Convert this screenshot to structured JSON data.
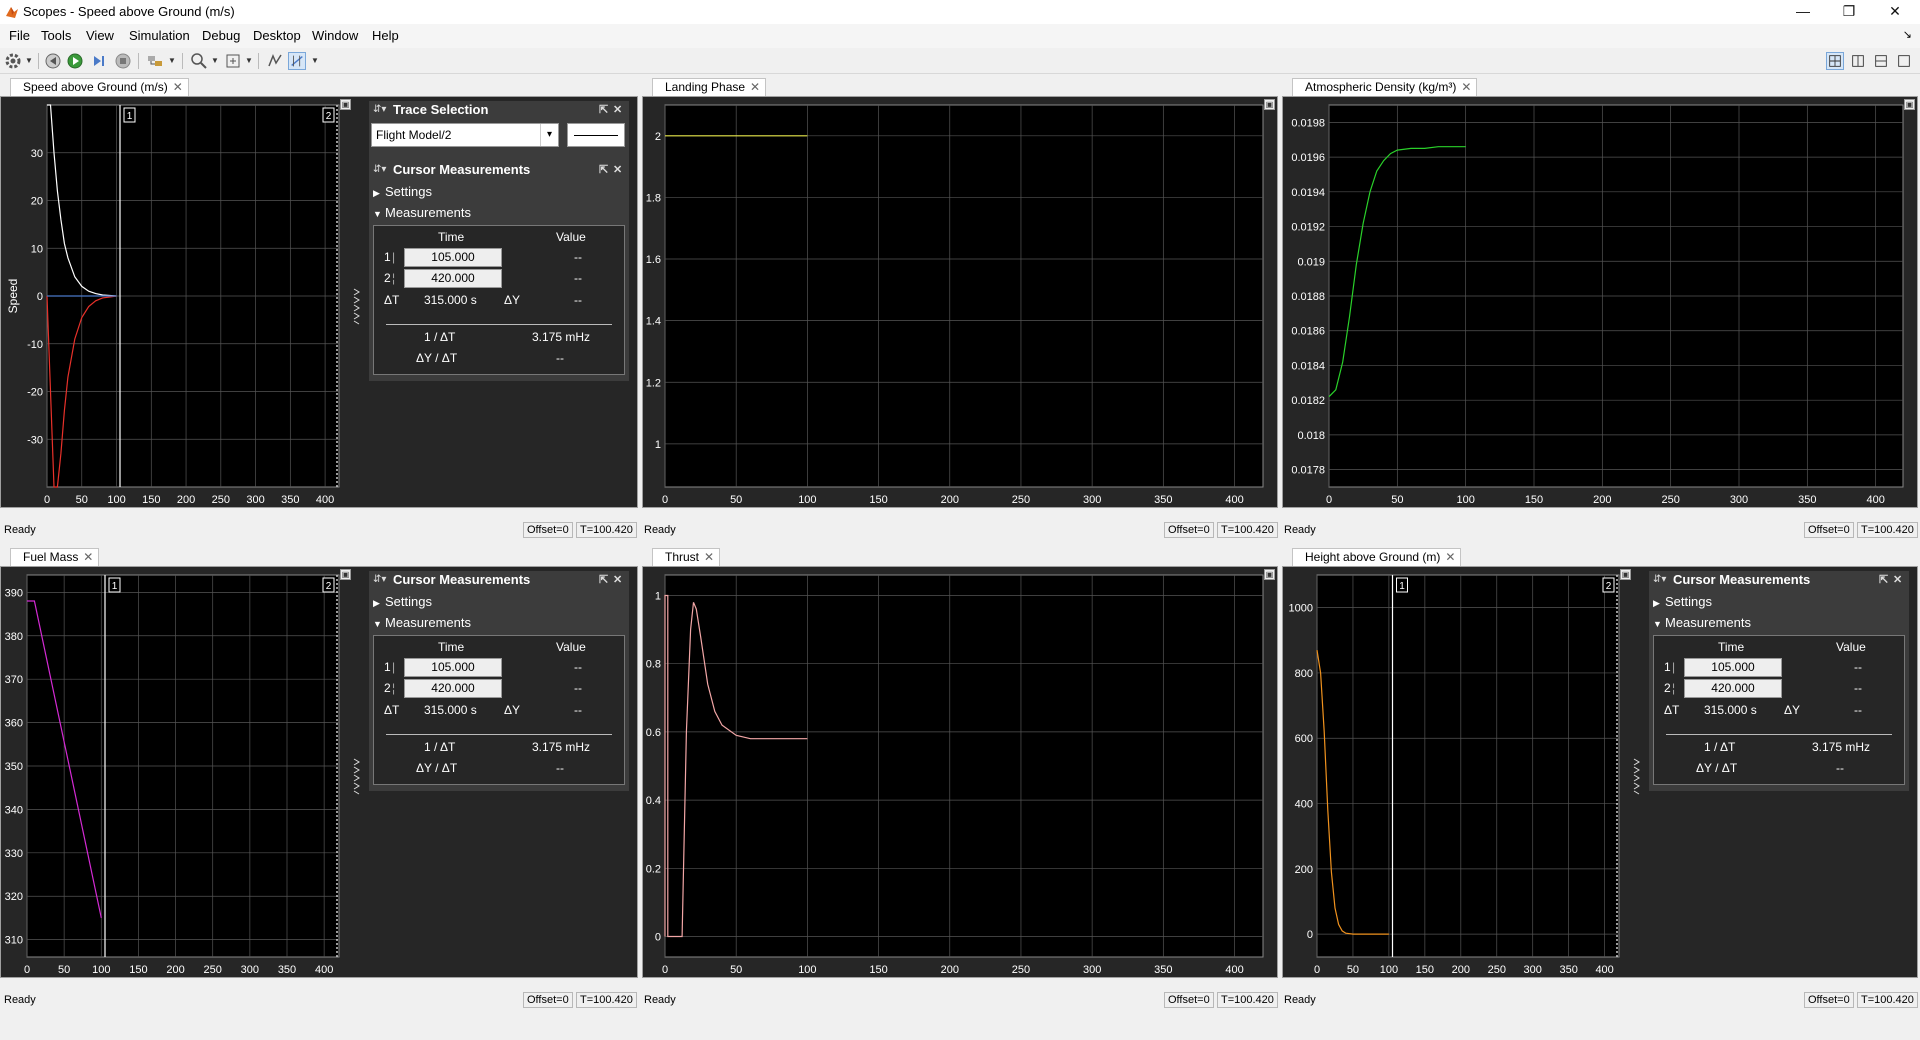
{
  "window": {
    "title": "Scopes - Speed above Ground (m/s)",
    "min": "—",
    "max": "❐",
    "close": "✕"
  },
  "menu": {
    "file": "File",
    "tools": "Tools",
    "view": "View",
    "simulation": "Simulation",
    "debug": "Debug",
    "desktop": "Desktop",
    "window": "Window",
    "help": "Help"
  },
  "status": {
    "ready": "Ready",
    "offset": "Offset=0",
    "time": "T=100.420"
  },
  "trace_selection": {
    "title": "Trace Selection",
    "value": "Flight Model/2"
  },
  "cursor": {
    "title": "Cursor Measurements",
    "settings": "Settings",
    "measurements": "Measurements",
    "col_time": "Time",
    "col_value": "Value",
    "c1_label": "1",
    "c2_label": "2",
    "c1_time": "105.000",
    "c2_time": "420.000",
    "c1_value": "--",
    "c2_value": "--",
    "dt_label": "ΔT",
    "dt_value": "315.000 s",
    "dy_label": "ΔY",
    "dy_value": "--",
    "inv_dt_label": "1 / ΔT",
    "inv_dt_value": "3.175 mHz",
    "dydt_label": "ΔY / ΔT",
    "dydt_value": "--"
  },
  "scopes": {
    "speed": {
      "tab": "Speed above Ground (m/s)",
      "ylabel": "Speed"
    },
    "landing": {
      "tab": "Landing Phase"
    },
    "density": {
      "tab": "Atmospheric Density (kg/m³)"
    },
    "fuel": {
      "tab": "Fuel Mass"
    },
    "thrust": {
      "tab": "Thrust"
    },
    "height": {
      "tab": "Height above Ground (m)"
    }
  },
  "chart_data": [
    {
      "id": "speed",
      "type": "line",
      "title": "Speed above Ground (m/s)",
      "ylabel": "Speed",
      "xlim": [
        0,
        420
      ],
      "ylim": [
        -40,
        40
      ],
      "xticks": [
        0,
        50,
        100,
        150,
        200,
        250,
        300,
        350,
        400
      ],
      "yticks": [
        -30,
        -20,
        -10,
        0,
        10,
        20,
        30
      ],
      "cursors": [
        105,
        420
      ],
      "series": [
        {
          "color": "#ffffff",
          "x": [
            0,
            5,
            10,
            15,
            20,
            25,
            30,
            40,
            50,
            60,
            70,
            80,
            90,
            100
          ],
          "y": [
            40,
            40,
            30,
            22,
            16,
            11,
            8,
            4,
            2,
            1,
            0.5,
            0.2,
            0.1,
            0
          ]
        },
        {
          "color": "#e8312a",
          "x": [
            0,
            5,
            10,
            15,
            20,
            25,
            30,
            40,
            50,
            60,
            70,
            80,
            90,
            100
          ],
          "y": [
            0,
            -20,
            -40,
            -40,
            -33,
            -24,
            -17,
            -9,
            -4.5,
            -2.2,
            -1,
            -0.4,
            -0.2,
            0
          ]
        },
        {
          "color": "#4a78c8",
          "x": [
            0,
            10,
            20,
            30,
            40,
            50,
            60,
            70,
            80,
            90,
            100
          ],
          "y": [
            0,
            0,
            0,
            0,
            0,
            0,
            0,
            0,
            0,
            0,
            0
          ]
        }
      ]
    },
    {
      "id": "landing",
      "type": "line",
      "title": "Landing Phase",
      "xlim": [
        0,
        420
      ],
      "ylim": [
        0.86,
        2.1
      ],
      "xticks": [
        0,
        50,
        100,
        150,
        200,
        250,
        300,
        350,
        400
      ],
      "yticks": [
        1,
        1.2,
        1.4,
        1.6,
        1.8,
        2
      ],
      "series": [
        {
          "color": "#e8e84a",
          "x": [
            0,
            100
          ],
          "y": [
            2,
            2
          ]
        }
      ]
    },
    {
      "id": "density",
      "type": "line",
      "title": "Atmospheric Density (kg/m³)",
      "xlim": [
        0,
        420
      ],
      "ylim": [
        0.0177,
        0.0199
      ],
      "xticks": [
        0,
        50,
        100,
        150,
        200,
        250,
        300,
        350,
        400
      ],
      "yticks": [
        0.0178,
        0.018,
        0.0182,
        0.0184,
        0.0186,
        0.0188,
        0.019,
        0.0192,
        0.0194,
        0.0196,
        0.0198
      ],
      "ytick_labels": [
        "0.0178",
        "0.018",
        "0.0182",
        "0.0184",
        "0.0186",
        "0.0188",
        "0.019",
        "0.0192",
        "0.0194",
        "0.0196",
        "0.0198"
      ],
      "series": [
        {
          "color": "#2ad12a",
          "x": [
            0,
            5,
            10,
            15,
            20,
            25,
            30,
            35,
            40,
            45,
            50,
            60,
            70,
            80,
            100
          ],
          "y": [
            0.01822,
            0.01826,
            0.01842,
            0.01868,
            0.01898,
            0.01922,
            0.0194,
            0.01952,
            0.01958,
            0.01962,
            0.01964,
            0.01965,
            0.01965,
            0.01966,
            0.01966
          ]
        }
      ]
    },
    {
      "id": "fuel",
      "type": "line",
      "title": "Fuel Mass",
      "xlim": [
        0,
        420
      ],
      "ylim": [
        306,
        394
      ],
      "xticks": [
        0,
        50,
        100,
        150,
        200,
        250,
        300,
        350,
        400
      ],
      "yticks": [
        310,
        320,
        330,
        340,
        350,
        360,
        370,
        380,
        390
      ],
      "cursors": [
        105,
        420
      ],
      "series": [
        {
          "color": "#d42ad4",
          "x": [
            0,
            10,
            100
          ],
          "y": [
            388,
            388,
            315
          ]
        }
      ]
    },
    {
      "id": "thrust",
      "type": "line",
      "title": "Thrust",
      "xlim": [
        0,
        420
      ],
      "ylim": [
        -0.06,
        1.06
      ],
      "xticks": [
        0,
        50,
        100,
        150,
        200,
        250,
        300,
        350,
        400
      ],
      "yticks": [
        0,
        0.2,
        0.4,
        0.6,
        0.8,
        1
      ],
      "series": [
        {
          "color": "#f2a6a6",
          "x": [
            0,
            0,
            2,
            2,
            12,
            15,
            18,
            20,
            22,
            25,
            30,
            35,
            40,
            50,
            60,
            70,
            80,
            100
          ],
          "y": [
            0,
            1,
            1,
            0,
            0,
            0.6,
            0.9,
            0.98,
            0.96,
            0.88,
            0.74,
            0.66,
            0.62,
            0.59,
            0.58,
            0.58,
            0.58,
            0.58
          ]
        }
      ]
    },
    {
      "id": "height",
      "type": "line",
      "title": "Height above Ground (m)",
      "xlim": [
        0,
        420
      ],
      "ylim": [
        -70,
        1100
      ],
      "xticks": [
        0,
        50,
        100,
        150,
        200,
        250,
        300,
        350,
        400
      ],
      "yticks": [
        0,
        200,
        400,
        600,
        800,
        1000
      ],
      "cursors": [
        105,
        420
      ],
      "series": [
        {
          "color": "#f0921e",
          "x": [
            0,
            5,
            10,
            15,
            20,
            25,
            30,
            35,
            40,
            50,
            60,
            70,
            80,
            100
          ],
          "y": [
            870,
            800,
            620,
            380,
            190,
            80,
            30,
            10,
            3,
            0,
            0,
            0,
            0,
            0
          ]
        }
      ]
    }
  ]
}
